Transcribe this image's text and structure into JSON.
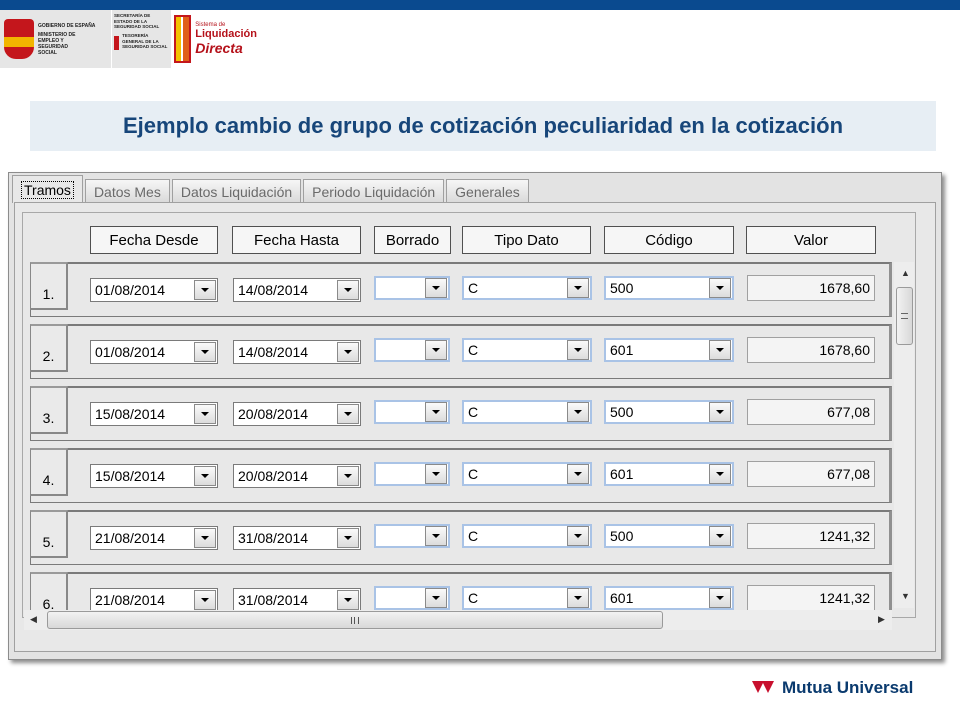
{
  "header": {
    "gobierno_text": "GOBIERNO DE ESPAÑA",
    "ministerio_text": "MINISTERIO DE EMPLEO Y SEGURIDAD SOCIAL",
    "secretaria_text": "SECRETARÍA DE ESTADO DE LA SEGURIDAD SOCIAL",
    "tesoreria_text": "TESORERÍA GENERAL DE LA SEGURIDAD SOCIAL",
    "sld_line1": "Sistema de",
    "sld_line2": "Liquidación",
    "sld_line3": "Directa"
  },
  "slide_title": "Ejemplo cambio de grupo de cotización peculiaridad en la cotización",
  "tabs": [
    "Tramos",
    "Datos Mes",
    "Datos Liquidación",
    "Periodo Liquidación",
    "Generales"
  ],
  "active_tab": "Tramos",
  "columns": [
    "Fecha Desde",
    "Fecha Hasta",
    "Borrado",
    "Tipo Dato",
    "Código",
    "Valor"
  ],
  "rows": [
    {
      "num": "1.",
      "fecha_desde": "01/08/2014",
      "fecha_hasta": "14/08/2014",
      "borrado": "",
      "tipo_dato": "C",
      "codigo": "500",
      "valor": "1678,60"
    },
    {
      "num": "2.",
      "fecha_desde": "01/08/2014",
      "fecha_hasta": "14/08/2014",
      "borrado": "",
      "tipo_dato": "C",
      "codigo": "601",
      "valor": "1678,60"
    },
    {
      "num": "3.",
      "fecha_desde": "15/08/2014",
      "fecha_hasta": "20/08/2014",
      "borrado": "",
      "tipo_dato": "C",
      "codigo": "500",
      "valor": "677,08"
    },
    {
      "num": "4.",
      "fecha_desde": "15/08/2014",
      "fecha_hasta": "20/08/2014",
      "borrado": "",
      "tipo_dato": "C",
      "codigo": "601",
      "valor": "677,08"
    },
    {
      "num": "5.",
      "fecha_desde": "21/08/2014",
      "fecha_hasta": "31/08/2014",
      "borrado": "",
      "tipo_dato": "C",
      "codigo": "500",
      "valor": "1241,32"
    },
    {
      "num": "6.",
      "fecha_desde": "21/08/2014",
      "fecha_hasta": "31/08/2014",
      "borrado": "",
      "tipo_dato": "C",
      "codigo": "601",
      "valor": "1241,32"
    }
  ],
  "footer": {
    "brand": "Mutua Universal"
  },
  "colors": {
    "title": "#17467a",
    "title_band": "#e7eef4",
    "top_bar": "#0a4a8f",
    "brand_red": "#c8102e"
  }
}
